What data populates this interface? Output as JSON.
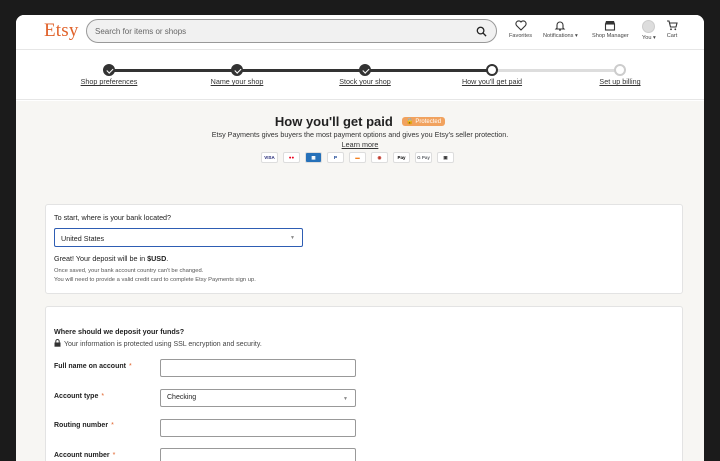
{
  "header": {
    "logo": "Etsy",
    "search_placeholder": "Search for items or shops",
    "nav": {
      "favorites": "Favorites",
      "notifications": "Notifications",
      "shop_manager": "Shop Manager",
      "you": "You",
      "cart": "Cart"
    },
    "icons": {
      "search": "search-icon",
      "favorites": "heart-icon",
      "notifications": "bell-icon",
      "shop_manager": "shop-icon",
      "cart": "cart-icon"
    },
    "brand_color": "#e0622a"
  },
  "stepper": {
    "steps": [
      {
        "label": "Shop preferences",
        "state": "done"
      },
      {
        "label": "Name your shop",
        "state": "done"
      },
      {
        "label": "Stock your shop",
        "state": "done"
      },
      {
        "label": "How you'll get paid",
        "state": "current"
      },
      {
        "label": "Set up billing",
        "state": "todo"
      }
    ]
  },
  "main": {
    "title": "How you'll get paid",
    "badge": "Protected",
    "subtitle": "Etsy Payments gives buyers the most payment options and gives you Etsy's seller protection.",
    "learn_more": "Learn more",
    "payment_methods": [
      "VISA",
      "MC",
      "AMEX",
      "PayPal",
      "DISC",
      "Klarna",
      "Pay",
      "GPay",
      "Gift"
    ]
  },
  "bank_location": {
    "question": "To start, where is your bank located?",
    "selected_country": "United States",
    "deposit_prefix": "Great! Your deposit will be in ",
    "deposit_currency": "$USD",
    "deposit_suffix": ".",
    "note_1": "Once saved, your bank account country can't be changed.",
    "note_2": "You will need to provide a valid credit card to complete Etsy Payments sign up."
  },
  "deposit_form": {
    "question": "Where should we deposit your funds?",
    "security_note": "Your information is protected using SSL encryption and security.",
    "full_name_label": "Full name on account",
    "account_type_label": "Account type",
    "account_type_value": "Checking",
    "routing_label": "Routing number",
    "account_number_label": "Account number",
    "required_mark": "*"
  }
}
